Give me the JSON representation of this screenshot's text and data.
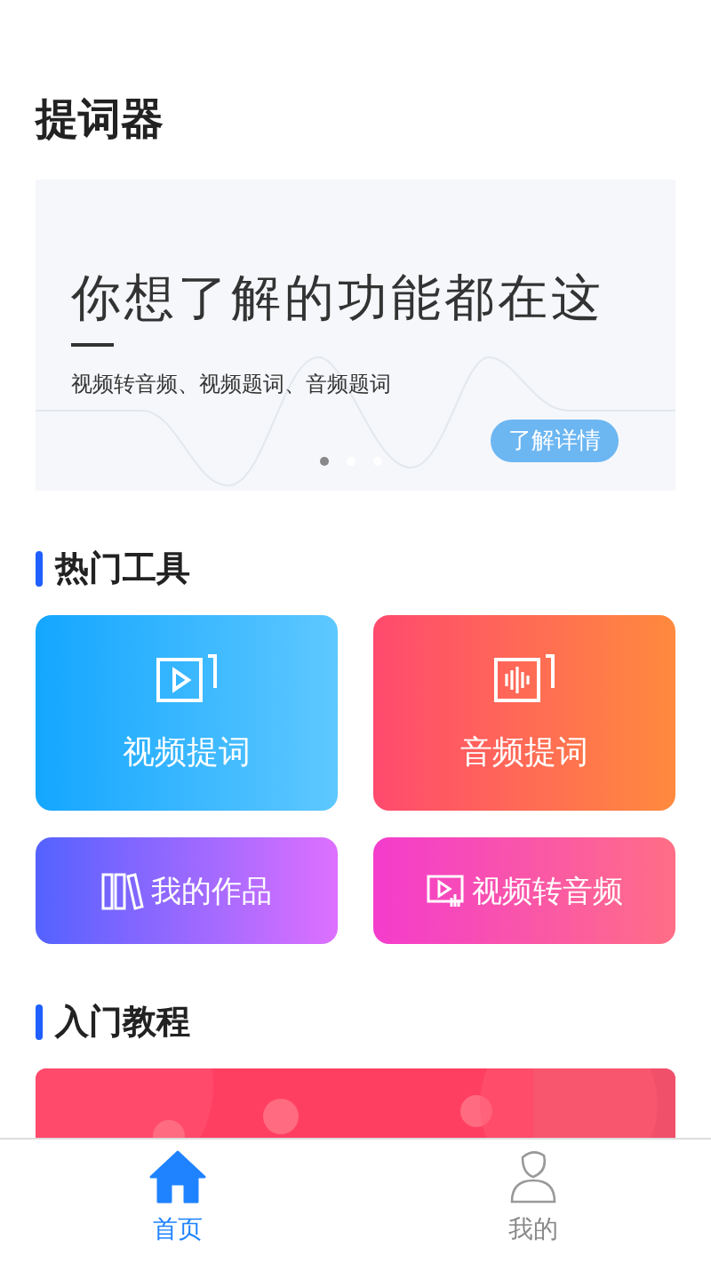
{
  "title": "提词器",
  "banner": {
    "headline": "你想了解的功能都在这",
    "subtitle": "视频转音频、视频题词、音频题词",
    "button": "了解详情",
    "dots": [
      {
        "selected": true
      },
      {
        "selected": false
      },
      {
        "selected": false
      }
    ]
  },
  "hot_tools": {
    "heading": "热门工具",
    "tiles": [
      {
        "kind": "large",
        "label": "视频提词"
      },
      {
        "kind": "large",
        "label": "音频提词"
      },
      {
        "kind": "small",
        "label": "我的作品"
      },
      {
        "kind": "small",
        "label": "视频转音频"
      }
    ]
  },
  "tutorials": {
    "heading": "入门教程"
  },
  "tab_bar": [
    {
      "label": "首页",
      "selected": true
    },
    {
      "label": "我的",
      "selected": false
    }
  ]
}
